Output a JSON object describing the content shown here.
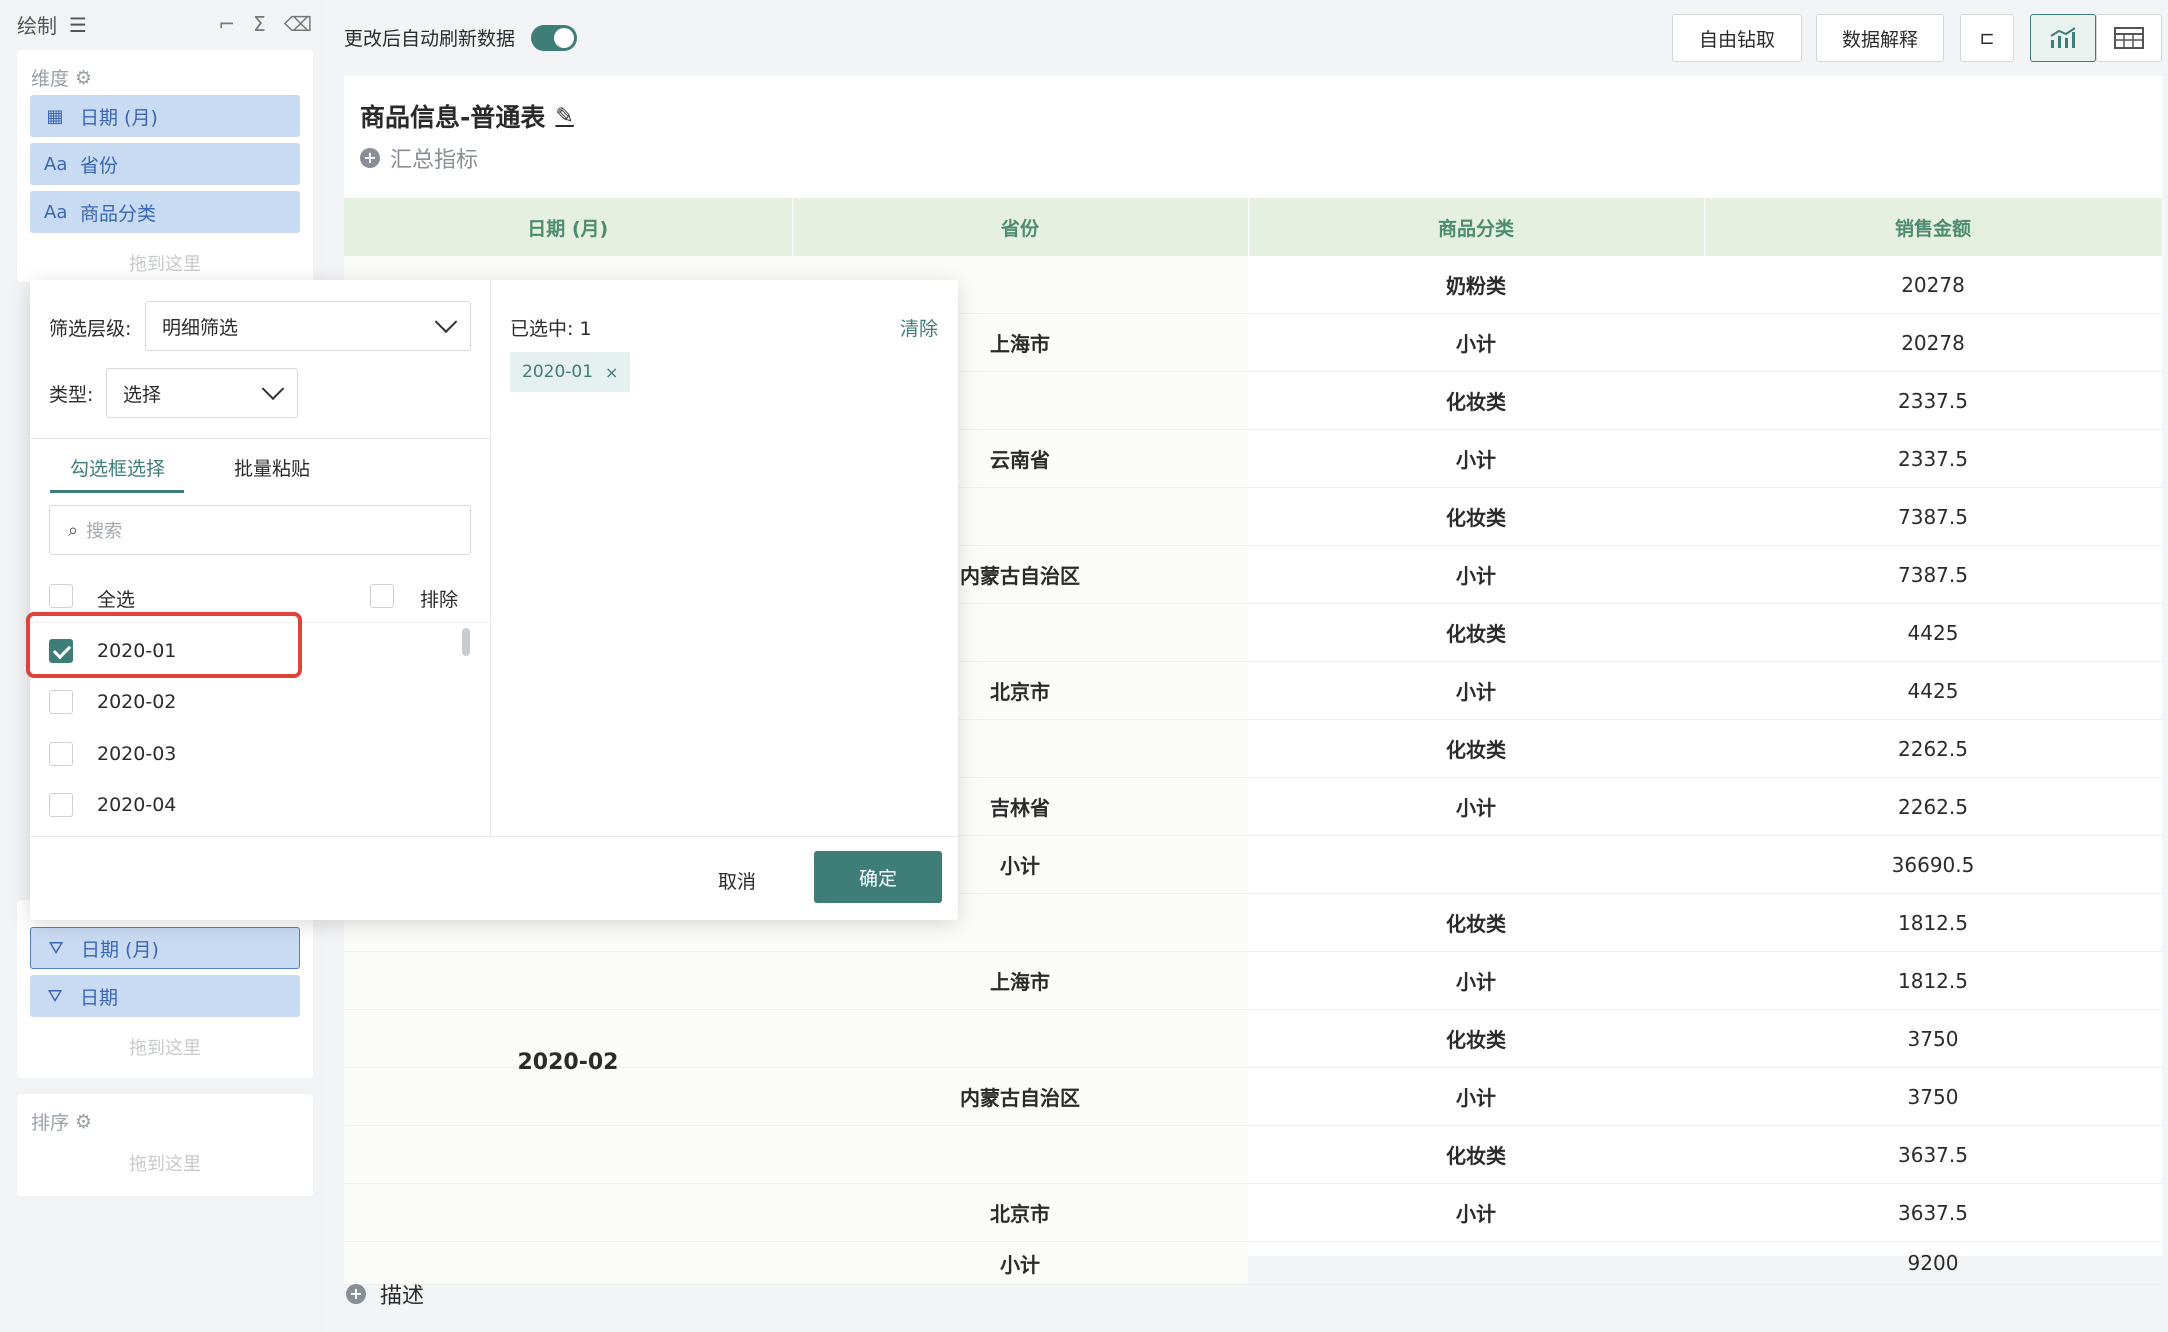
{
  "left": {
    "section_title": "绘制",
    "dimensions_label": "维度",
    "dimension_fields": [
      {
        "type_icon": "日",
        "label": "日期 (月)"
      },
      {
        "type_icon": "Aa",
        "label": "省份"
      },
      {
        "type_icon": "Aa",
        "label": "商品分类"
      }
    ],
    "drop_hint": "拖到这里",
    "filter_fields": [
      {
        "label": "日期 (月)"
      },
      {
        "label": "日期"
      }
    ],
    "sort_label": "排序"
  },
  "topbar": {
    "auto_refresh_label": "更改后自动刷新数据",
    "drill_label": "自由钻取",
    "explain_label": "数据解释"
  },
  "chart": {
    "title": "商品信息-普通表",
    "summary_label": "汇总指标",
    "description_label": "描述",
    "columns": [
      "日期 (月)",
      "省份",
      "商品分类",
      "销售金额"
    ],
    "rows": [
      {
        "date": "",
        "province": "",
        "category": "奶粉类",
        "amount": "20278"
      },
      {
        "date": "",
        "province": "上海市",
        "category": "小计",
        "amount": "20278"
      },
      {
        "date": "",
        "province": "",
        "category": "化妆类",
        "amount": "2337.5"
      },
      {
        "date": "",
        "province": "云南省",
        "category": "小计",
        "amount": "2337.5"
      },
      {
        "date": "",
        "province": "",
        "category": "化妆类",
        "amount": "7387.5"
      },
      {
        "date": "",
        "province": "内蒙古自治区",
        "category": "小计",
        "amount": "7387.5"
      },
      {
        "date": "",
        "province": "",
        "category": "化妆类",
        "amount": "4425"
      },
      {
        "date": "",
        "province": "北京市",
        "category": "小计",
        "amount": "4425"
      },
      {
        "date": "",
        "province": "",
        "category": "化妆类",
        "amount": "2262.5"
      },
      {
        "date": "",
        "province": "吉林省",
        "category": "小计",
        "amount": "2262.5"
      },
      {
        "date": "",
        "province": "小计",
        "category": "",
        "amount": "36690.5"
      },
      {
        "date": "",
        "province": "",
        "category": "化妆类",
        "amount": "1812.5"
      },
      {
        "date": "",
        "province": "上海市",
        "category": "小计",
        "amount": "1812.5"
      },
      {
        "date": "",
        "province": "",
        "category": "化妆类",
        "amount": "3750"
      },
      {
        "date": "",
        "province": "内蒙古自治区",
        "category": "小计",
        "amount": "3750"
      },
      {
        "date": "",
        "province": "",
        "category": "化妆类",
        "amount": "3637.5"
      },
      {
        "date": "",
        "province": "北京市",
        "category": "小计",
        "amount": "3637.5"
      },
      {
        "date": "",
        "province": "小计",
        "category": "",
        "amount": "9200"
      }
    ],
    "date_group_label": "2020-02"
  },
  "filter_popup": {
    "level_label": "筛选层级:",
    "level_value": "明细筛选",
    "type_label": "类型:",
    "type_value": "选择",
    "tab_checkbox": "勾选框选择",
    "tab_paste": "批量粘贴",
    "search_placeholder": "搜索",
    "select_all": "全选",
    "exclude": "排除",
    "options": [
      {
        "label": "2020-01",
        "checked": true
      },
      {
        "label": "2020-02",
        "checked": false
      },
      {
        "label": "2020-03",
        "checked": false
      },
      {
        "label": "2020-04",
        "checked": false
      }
    ],
    "selected_count_label": "已选中: 1",
    "clear_label": "清除",
    "selected_tag": "2020-01",
    "cancel_label": "取消",
    "confirm_label": "确定"
  },
  "colors": {
    "accent": "#3f7d79",
    "header_bg": "#e5f0e1",
    "header_text": "#4e8b72",
    "pill_bg": "#c9dbf3",
    "highlight": "#e0413a"
  }
}
